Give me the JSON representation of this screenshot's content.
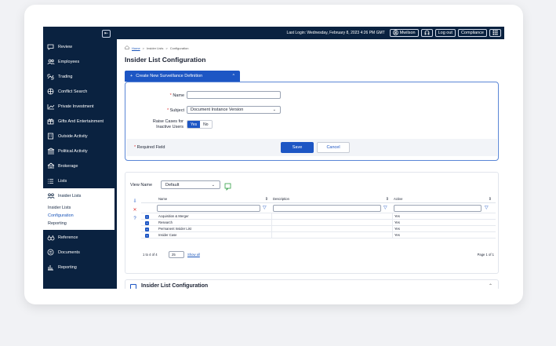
{
  "topbar": {
    "last_login": "Last Login: Wednesday, February 8, 2023 4:26 PM GMT",
    "user": "Mwilson",
    "logout": "Log out",
    "compliance": "Compliance"
  },
  "sidebar": {
    "items": [
      {
        "label": "Review",
        "icon": "chat-icon"
      },
      {
        "label": "Employees",
        "icon": "people-icon"
      },
      {
        "label": "Trading",
        "icon": "trading-icon"
      },
      {
        "label": "Conflict Search",
        "icon": "conflict-icon"
      },
      {
        "label": "Private Investment",
        "icon": "chart-icon"
      },
      {
        "label": "Gifts And Entertainment",
        "icon": "gift-icon"
      },
      {
        "label": "Outside Activity",
        "icon": "building-icon"
      },
      {
        "label": "Political Activity",
        "icon": "capitol-icon"
      },
      {
        "label": "Brokerage",
        "icon": "brokerage-icon"
      },
      {
        "label": "Lists",
        "icon": "list-icon"
      },
      {
        "label": "Insider Lists",
        "icon": "insider-icon"
      }
    ],
    "submenu": [
      "Insider Lists",
      "Configuration",
      "Reporting"
    ],
    "items_after": [
      {
        "label": "Reference",
        "icon": "binoculars-icon"
      },
      {
        "label": "Documents",
        "icon": "document-icon"
      },
      {
        "label": "Reporting",
        "icon": "reporting-icon"
      }
    ]
  },
  "breadcrumb": {
    "home": "Home",
    "sep": ">",
    "level1": "Insider Lists",
    "level2": "Configuration"
  },
  "page": {
    "title": "Insider List Configuration"
  },
  "create_tab": {
    "plus": "+",
    "label": "Create New Surveillance Definition",
    "chevron": "^"
  },
  "form": {
    "name_label": "Name",
    "subject_label": "Subject",
    "subject_value": "Document Instance Version",
    "raise_label_line1": "Raise Cases for",
    "raise_label_line2": "Inactive Users",
    "yes": "Yes",
    "no": "No",
    "required_note": "Required Field",
    "save": "Save",
    "cancel": "Cancel"
  },
  "list": {
    "view_name_label": "View Name",
    "view_value": "Default",
    "columns": [
      "Name",
      "Description",
      "Active"
    ],
    "rows": [
      {
        "name": "Acquisition & Merger",
        "description": "",
        "active": "Yes"
      },
      {
        "name": "Research",
        "description": "",
        "active": "Yes"
      },
      {
        "name": "Permanent Insider List",
        "description": "",
        "active": "Yes"
      },
      {
        "name": "Insider Case",
        "description": "",
        "active": "Yes"
      }
    ],
    "range": "1 to 4 of 4",
    "page_size": "25",
    "show_all": "Show all",
    "page_info": "Page 1 of 1"
  },
  "bottom_section": {
    "label": "Insider List Configuration"
  }
}
